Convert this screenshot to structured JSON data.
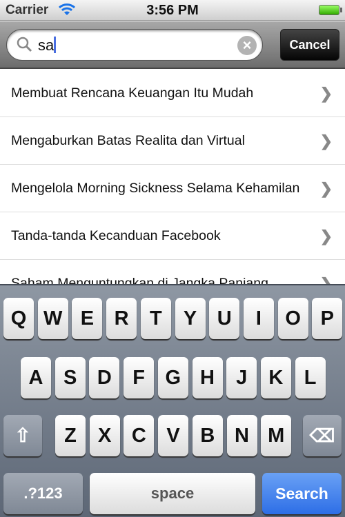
{
  "status": {
    "carrier": "Carrier",
    "time": "3:56 PM"
  },
  "search": {
    "query": "sa",
    "cancel_label": "Cancel"
  },
  "results": [
    "Membuat Rencana Keuangan Itu Mudah",
    "Mengaburkan Batas Realita dan Virtual",
    "Mengelola Morning Sickness Selama Kehamilan",
    "Tanda-tanda Kecanduan Facebook",
    "Saham Menguntungkan di Jangka Panjang"
  ],
  "keyboard": {
    "row1": [
      "Q",
      "W",
      "E",
      "R",
      "T",
      "Y",
      "U",
      "I",
      "O",
      "P"
    ],
    "row2": [
      "A",
      "S",
      "D",
      "F",
      "G",
      "H",
      "J",
      "K",
      "L"
    ],
    "row3": [
      "Z",
      "X",
      "C",
      "V",
      "B",
      "N",
      "M"
    ],
    "numbers_label": ".?123",
    "space_label": "space",
    "search_label": "Search"
  }
}
